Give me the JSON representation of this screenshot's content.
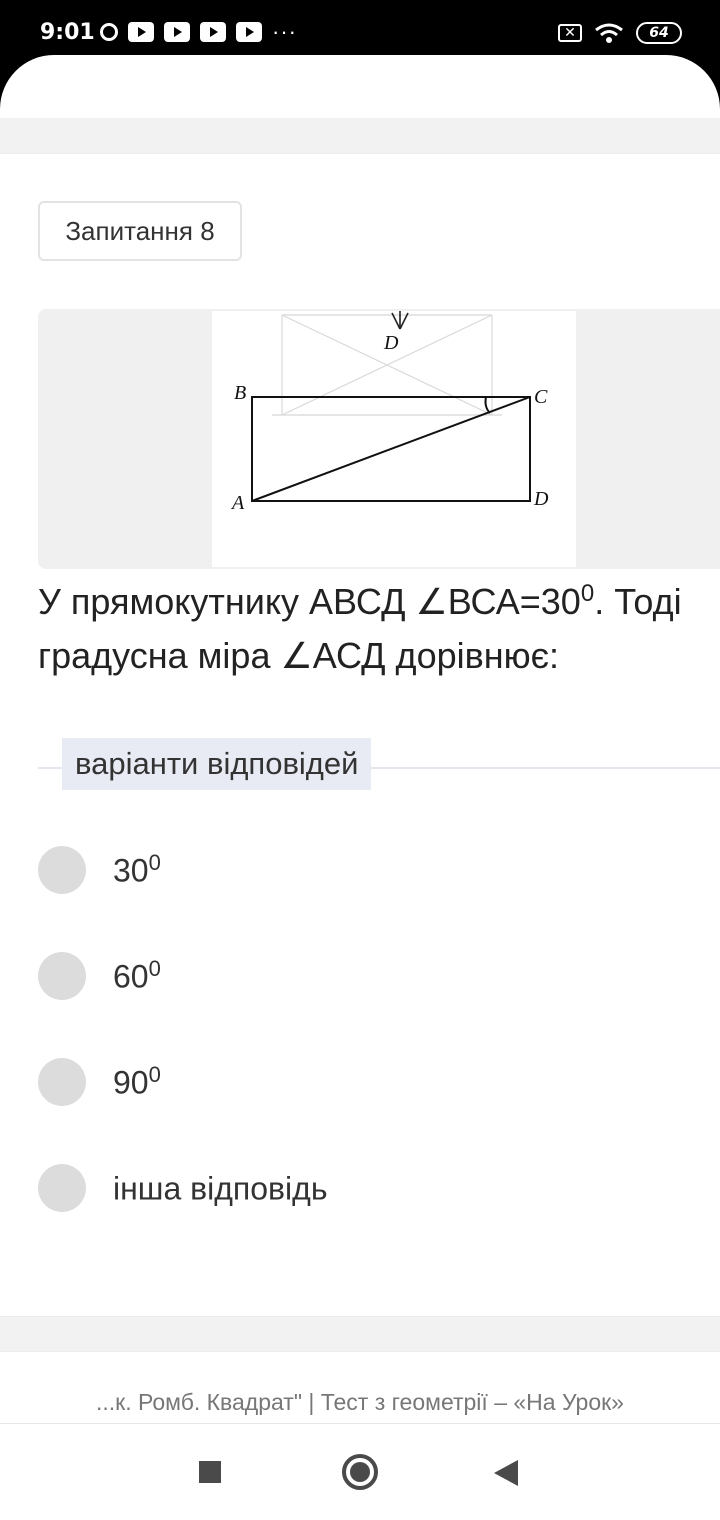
{
  "status_bar": {
    "time": "9:01",
    "battery": "64",
    "icons": [
      "disc-notification-icon",
      "youtube-icon",
      "youtube-icon",
      "youtube-icon",
      "youtube-icon",
      "more-dots-icon",
      "no-sim-icon",
      "wifi-icon",
      "battery-icon"
    ],
    "dots": "···"
  },
  "question": {
    "number_label": "Запитання 8",
    "text_part1": "У прямокутнику АВСД ∠ВСА=30",
    "sup1": "0",
    "text_part2": ". Тоді",
    "text_line2": "градусна міра ∠АСД дорівнює:"
  },
  "figure": {
    "vertex_labels": {
      "A": "A",
      "B": "B",
      "C": "C",
      "D": "D",
      "D_top": "D"
    }
  },
  "answers": {
    "section_label": "варіанти відповідей",
    "options": [
      {
        "value": "30",
        "sup": "0"
      },
      {
        "value": "60",
        "sup": "0"
      },
      {
        "value": "90",
        "sup": "0"
      },
      {
        "value": "інша відповідь",
        "sup": ""
      }
    ]
  },
  "footer": {
    "page_title": "...к. Ромб. Квадрат\" | Тест з геометрії – «На Урок»"
  },
  "nav": {
    "buttons": [
      "recents-square-icon",
      "home-circle-icon",
      "back-triangle-icon"
    ]
  }
}
